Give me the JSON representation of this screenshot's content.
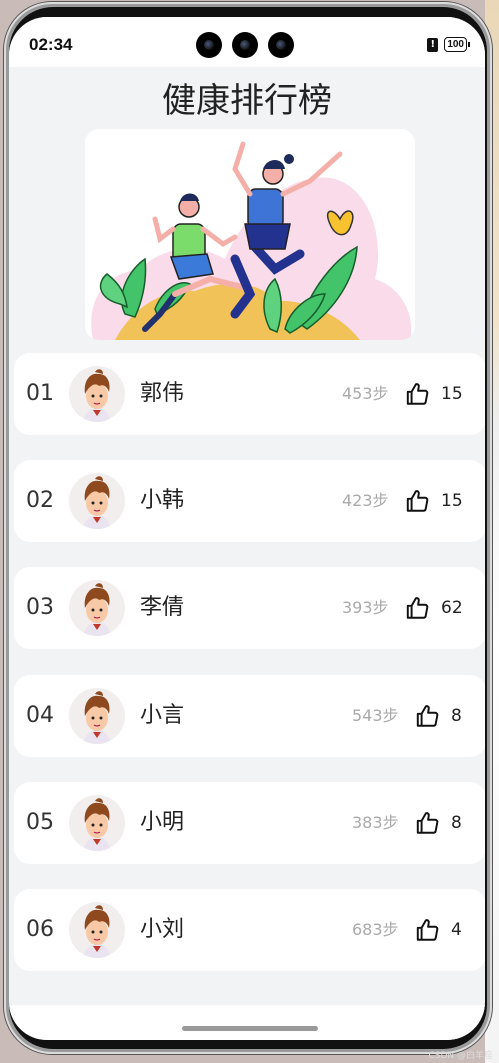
{
  "status": {
    "time": "02:34",
    "battery": "100"
  },
  "page": {
    "title": "健康排行榜"
  },
  "rankings": [
    {
      "rank": "01",
      "name": "郭伟",
      "steps": "453步",
      "likes": "15"
    },
    {
      "rank": "02",
      "name": "小韩",
      "steps": "423步",
      "likes": "15"
    },
    {
      "rank": "03",
      "name": "李倩",
      "steps": "393步",
      "likes": "62"
    },
    {
      "rank": "04",
      "name": "小言",
      "steps": "543步",
      "likes": "8"
    },
    {
      "rank": "05",
      "name": "小明",
      "steps": "383步",
      "likes": "8"
    },
    {
      "rank": "06",
      "name": "小刘",
      "steps": "683步",
      "likes": "4"
    }
  ],
  "watermark": "CSDN @白羊座",
  "icons": {
    "like": "thumbs-up-icon",
    "alert": "alert-icon",
    "battery": "battery-icon"
  }
}
